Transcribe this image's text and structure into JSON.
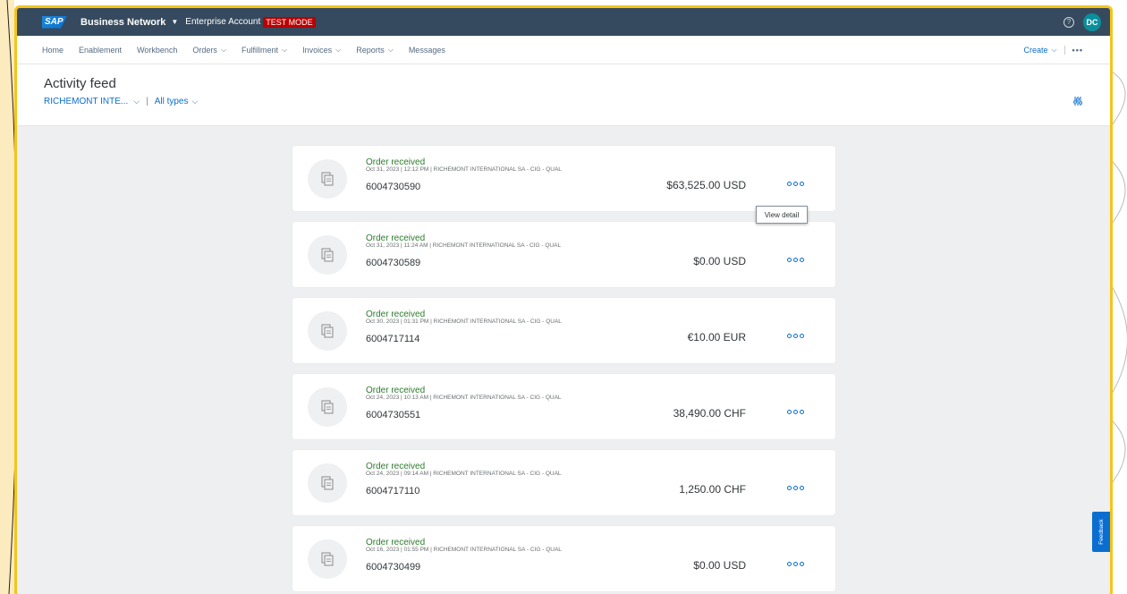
{
  "shell": {
    "logo": "SAP",
    "title": "Business Network",
    "account": "Enterprise Account",
    "badge": "TEST MODE",
    "help": "?",
    "avatar": "DC"
  },
  "nav": {
    "items": [
      {
        "label": "Home",
        "has_dropdown": false
      },
      {
        "label": "Enablement",
        "has_dropdown": false
      },
      {
        "label": "Workbench",
        "has_dropdown": false
      },
      {
        "label": "Orders",
        "has_dropdown": true
      },
      {
        "label": "Fulfillment",
        "has_dropdown": true
      },
      {
        "label": "Invoices",
        "has_dropdown": true
      },
      {
        "label": "Reports",
        "has_dropdown": true
      },
      {
        "label": "Messages",
        "has_dropdown": false
      }
    ],
    "create_label": "Create",
    "more_label": "•••"
  },
  "page": {
    "title": "Activity feed",
    "filter_customer": "RICHEMONT INTE...",
    "filter_type": "All types"
  },
  "feed": [
    {
      "type": "Order received",
      "meta": "Oct 31, 2023  |  12:12 PM  |  RICHEMONT INTERNATIONAL SA - CIG - QUAL",
      "number": "6004730590",
      "amount": "$63,525.00 USD"
    },
    {
      "type": "Order received",
      "meta": "Oct 31, 2023  |  11:24 AM  |  RICHEMONT INTERNATIONAL SA - CIG - QUAL",
      "number": "6004730589",
      "amount": "$0.00 USD"
    },
    {
      "type": "Order received",
      "meta": "Oct 30, 2023  |  01:31 PM  |  RICHEMONT INTERNATIONAL SA - CIG - QUAL",
      "number": "6004717114",
      "amount": "€10.00 EUR"
    },
    {
      "type": "Order received",
      "meta": "Oct 24, 2023  |  10:13 AM  |  RICHEMONT INTERNATIONAL SA - CIG - QUAL",
      "number": "6004730551",
      "amount": "38,490.00 CHF"
    },
    {
      "type": "Order received",
      "meta": "Oct 24, 2023  |  09:14 AM  |  RICHEMONT INTERNATIONAL SA - CIG - QUAL",
      "number": "6004717110",
      "amount": "1,250.00 CHF"
    },
    {
      "type": "Order received",
      "meta": "Oct 16, 2023  |  01:55 PM  |  RICHEMONT INTERNATIONAL SA - CIG - QUAL",
      "number": "6004730499",
      "amount": "$0.00 USD"
    }
  ],
  "tooltip": "View detail",
  "feedback": "Feedback",
  "colors": {
    "shell": "#354a5f",
    "accent": "#0a6ed1",
    "status_green": "#2b7c2b",
    "badge_red": "#bb0000",
    "highlight_border": "#f5c518"
  }
}
